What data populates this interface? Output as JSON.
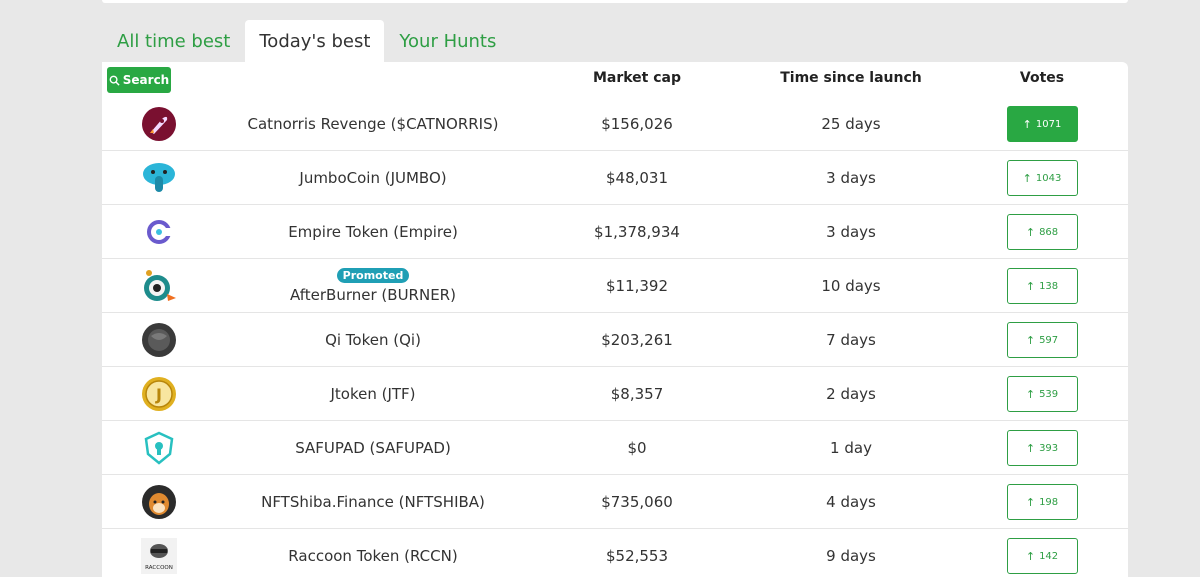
{
  "tabs": [
    {
      "label": "All time best",
      "active": false
    },
    {
      "label": "Today's best",
      "active": true
    },
    {
      "label": "Your Hunts",
      "active": false
    }
  ],
  "search": {
    "label": "Search",
    "icon": "search-icon"
  },
  "table": {
    "headers": {
      "market_cap": "Market cap",
      "time": "Time since launch",
      "votes": "Votes"
    },
    "rows": [
      {
        "name": "Catnorris Revenge ($CATNORRIS)",
        "market_cap": "$156,026",
        "time": "25 days",
        "votes": "1071",
        "voted": true,
        "promoted": "",
        "logo": "rocket-icon",
        "logo_color": "#7a1030"
      },
      {
        "name": "JumboCoin (JUMBO)",
        "market_cap": "$48,031",
        "time": "3 days",
        "votes": "1043",
        "voted": false,
        "promoted": "",
        "logo": "elephant-icon",
        "logo_color": "#2bb5d8"
      },
      {
        "name": "Empire Token (Empire)",
        "market_cap": "$1,378,934",
        "time": "3 days",
        "votes": "868",
        "voted": false,
        "promoted": "",
        "logo": "empire-icon",
        "logo_color": "#6a5acd"
      },
      {
        "name": "AfterBurner (BURNER)",
        "market_cap": "$11,392",
        "time": "10 days",
        "votes": "138",
        "voted": false,
        "promoted": "Promoted",
        "logo": "afterburner-icon",
        "logo_color": "#1e8c8c"
      },
      {
        "name": "Qi Token (Qi)",
        "market_cap": "$203,261",
        "time": "7 days",
        "votes": "597",
        "voted": false,
        "promoted": "",
        "logo": "qi-icon",
        "logo_color": "#3a3a3a"
      },
      {
        "name": "Jtoken (JTF)",
        "market_cap": "$8,357",
        "time": "2 days",
        "votes": "539",
        "voted": false,
        "promoted": "",
        "logo": "j-coin-icon",
        "logo_color": "#e0b020"
      },
      {
        "name": "SAFUPAD (SAFUPAD)",
        "market_cap": "$0",
        "time": "1 day",
        "votes": "393",
        "voted": false,
        "promoted": "",
        "logo": "shield-icon",
        "logo_color": "#28c0c0"
      },
      {
        "name": "NFTShiba.Finance (NFTSHIBA)",
        "market_cap": "$735,060",
        "time": "4 days",
        "votes": "198",
        "voted": false,
        "promoted": "",
        "logo": "shiba-icon",
        "logo_color": "#e08a30"
      },
      {
        "name": "Raccoon Token (RCCN)",
        "market_cap": "$52,553",
        "time": "9 days",
        "votes": "142",
        "voted": false,
        "promoted": "",
        "logo": "raccoon-icon",
        "logo_color": "#555555",
        "logo_text": "RACCOON"
      }
    ]
  },
  "colors": {
    "accent": "#29a843",
    "promoted": "#1f9fb5"
  }
}
